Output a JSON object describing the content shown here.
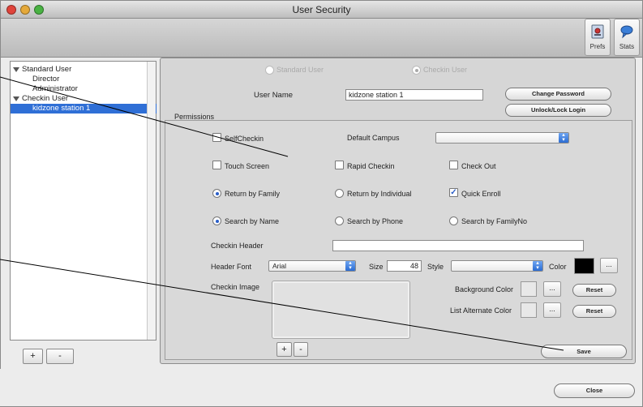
{
  "window": {
    "title": "User Security"
  },
  "toolbar": {
    "prefs_label": "Prefs",
    "stats_label": "Stats"
  },
  "tree": {
    "nodes": [
      {
        "label": "Standard User",
        "level": 0,
        "expanded": true
      },
      {
        "label": "Director",
        "level": 1
      },
      {
        "label": "Administrator",
        "level": 1
      },
      {
        "label": "Checkin User",
        "level": 0,
        "expanded": true
      },
      {
        "label": "kidzone station 1",
        "level": 1,
        "selected": true
      }
    ],
    "add_label": "+",
    "remove_label": "-"
  },
  "user_type": {
    "standard_label": "Standard User",
    "checkin_label": "Checkin User",
    "selected": "checkin"
  },
  "user": {
    "name_label": "User Name",
    "name_value": "kidzone station 1",
    "change_password_label": "Change Password",
    "unlock_label": "Unlock/Lock Login"
  },
  "permissions": {
    "group_label": "Permissions",
    "self_checkin": {
      "label": "SelfCheckin",
      "checked": false
    },
    "default_campus_label": "Default Campus",
    "default_campus_value": "",
    "touch_screen": {
      "label": "Touch Screen",
      "checked": false
    },
    "rapid_checkin": {
      "label": "Rapid Checkin",
      "checked": false
    },
    "check_out": {
      "label": "Check Out",
      "checked": false
    },
    "return_by_family": {
      "label": "Return by Family",
      "selected": true
    },
    "return_by_individual": {
      "label": "Return by Individual",
      "selected": false
    },
    "quick_enroll": {
      "label": "Quick Enroll",
      "checked": true
    },
    "search_by_name": {
      "label": "Search by Name",
      "selected": true
    },
    "search_by_phone": {
      "label": "Search by Phone",
      "selected": false
    },
    "search_by_familyno": {
      "label": "Search by FamilyNo",
      "selected": false
    },
    "checkin_header_label": "Checkin Header",
    "checkin_header_value": "",
    "header_font_label": "Header Font",
    "header_font_value": "Arial",
    "size_label": "Size",
    "size_value": "48",
    "style_label": "Style",
    "style_value": "",
    "color_label": "Color",
    "color_value": "#000000",
    "color_button_label": "...",
    "checkin_image_label": "Checkin Image",
    "image_add_label": "+",
    "image_remove_label": "-",
    "background_color_label": "Background Color",
    "background_button_label": "...",
    "background_reset_label": "Reset",
    "list_alternate_color_label": "List Alternate Color",
    "list_alternate_button_label": "...",
    "list_alternate_reset_label": "Reset",
    "save_label": "Save"
  },
  "footer": {
    "close_label": "Close"
  }
}
